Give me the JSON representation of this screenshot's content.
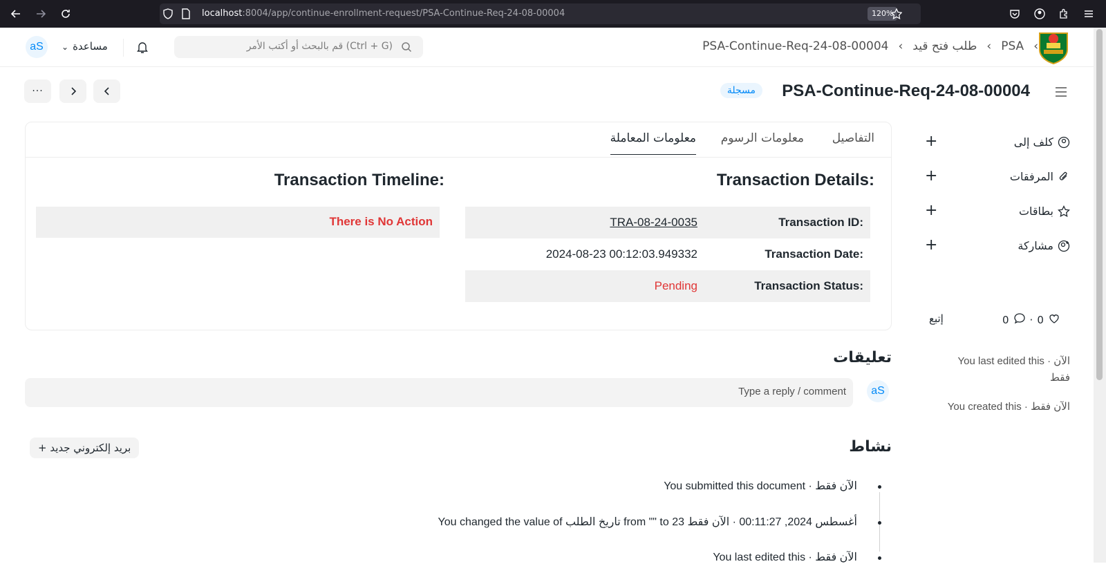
{
  "browser": {
    "url_host": "localhost",
    "url_rest": ":8004/app/continue-enrollment-request/PSA-Continue-Req-24-08-00004",
    "zoom": "120%"
  },
  "navbar": {
    "breadcrumbs": [
      "PSA",
      "طلب فتح قيد",
      "PSA-Continue-Req-24-08-00004"
    ],
    "search_placeholder": "قم بالبحث أو أكتب الأمر (Ctrl + G)",
    "help_label": "مساعدة",
    "avatar_initials": "aS"
  },
  "page": {
    "title": "PSA-Continue-Req-24-08-00004",
    "status_badge": "مسجلة",
    "more_label": "···"
  },
  "sidebar": {
    "items": [
      {
        "label": "كلف إلى",
        "icon": "assign-user-icon"
      },
      {
        "label": "المرفقات",
        "icon": "paperclip-icon"
      },
      {
        "label": "بطاقات",
        "icon": "star-icon"
      },
      {
        "label": "مشاركة",
        "icon": "share-user-icon"
      }
    ],
    "likes": "0",
    "comments": "0",
    "follow_label": "إتبع",
    "last_edited": "You last edited this · الآن",
    "last_edited_2": "فقط",
    "created": "You created this · الآن فقط"
  },
  "tabs": [
    "التفاصيل",
    "معلومات الرسوم",
    "معلومات المعاملة"
  ],
  "transaction": {
    "details_title": "Transaction Details:",
    "timeline_title": "Transaction Timeline:",
    "rows": [
      {
        "label": "Transaction ID:",
        "value": "TRA-08-24-0035"
      },
      {
        "label": "Transaction Date:",
        "value": "2024-08-23 00:12:03.949332"
      },
      {
        "label": "Transaction Status:",
        "value": "Pending"
      }
    ],
    "timeline_empty": "There is No Action"
  },
  "comments": {
    "title": "تعليقات",
    "placeholder": "Type a reply / comment",
    "avatar_initials": "aS"
  },
  "activity": {
    "title": "نشاط",
    "new_email": "+ بريد إلكتروني جديد",
    "items": [
      "You submitted this document · الآن فقط",
      "You changed the value of تاريخ الطلب from \"\" to 23 أغسطس 2024, 00:11:27 · الآن فقط",
      "You last edited this · الآن فقط"
    ]
  },
  "colors": {
    "accent": "#0289f7",
    "danger": "#e03636",
    "badge_bg": "#eaf5fe"
  }
}
